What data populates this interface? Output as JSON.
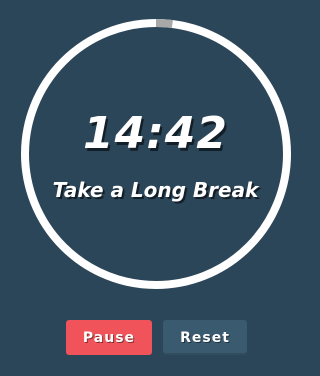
{
  "timer": {
    "time": "14:42",
    "label": "Take a Long Break",
    "progress_elapsed_fraction": 0.02
  },
  "controls": {
    "pause_label": "Pause",
    "reset_label": "Reset"
  },
  "colors": {
    "background": "#2c4659",
    "ring": "#ffffff",
    "ring_elapsed": "#a8a8a8",
    "pause_button": "#f0545a",
    "reset_button": "#3a5a70"
  }
}
